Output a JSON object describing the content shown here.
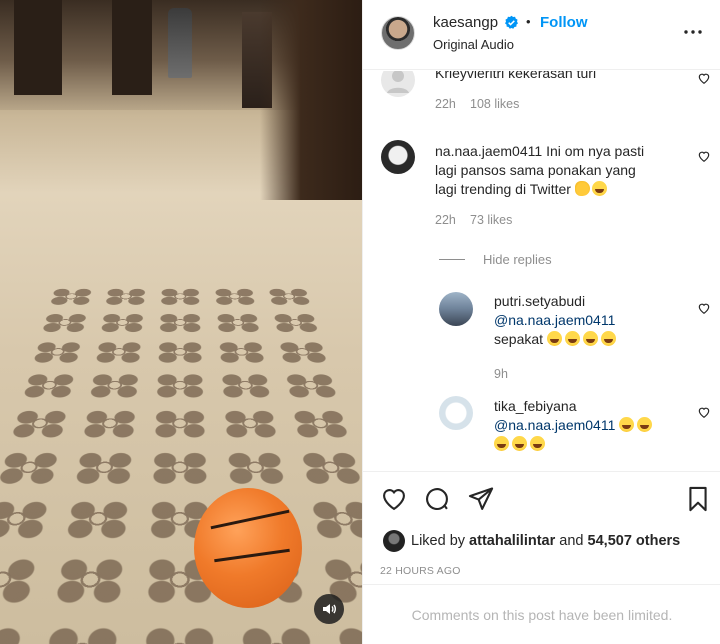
{
  "header": {
    "username": "kaesangp",
    "follow_label": "Follow",
    "separator": "•",
    "subtitle": "Original Audio"
  },
  "comments": [
    {
      "username": "Krieyvieritri",
      "text": "kekerasan turi",
      "time": "22h",
      "likes": "108 likes"
    },
    {
      "username": "na.naa.jaem0411",
      "text_line1": "Ini om nya pasti",
      "text_line2": "lagi pansos sama ponakan yang",
      "text_line3": "lagi trending di Twitter",
      "time": "22h",
      "likes": "73 likes"
    }
  ],
  "hide_replies_label": "Hide replies",
  "replies": [
    {
      "username": "putri.setyabudi",
      "mention": "@na.naa.jaem0411",
      "text": "sepakat",
      "time": "9h"
    },
    {
      "username": "tika_febiyana",
      "mention": "@na.naa.jaem0411"
    }
  ],
  "likes_summary": {
    "prefix": "Liked by",
    "user": "attahalilintar",
    "middle": "and",
    "count": "54,507 others"
  },
  "post_time": "22 HOURS AGO",
  "comments_limited": "Comments on this post have been limited.",
  "icons": {
    "more": "more-horizontal-icon",
    "like": "heart-icon",
    "comment": "comment-icon",
    "share": "paper-plane-icon",
    "save": "bookmark-icon",
    "sound": "speaker-icon",
    "verified": "verified-badge-icon"
  },
  "colors": {
    "accent": "#0095f6",
    "text": "#262626",
    "muted": "#8e8e8e",
    "mention": "#00376b"
  }
}
